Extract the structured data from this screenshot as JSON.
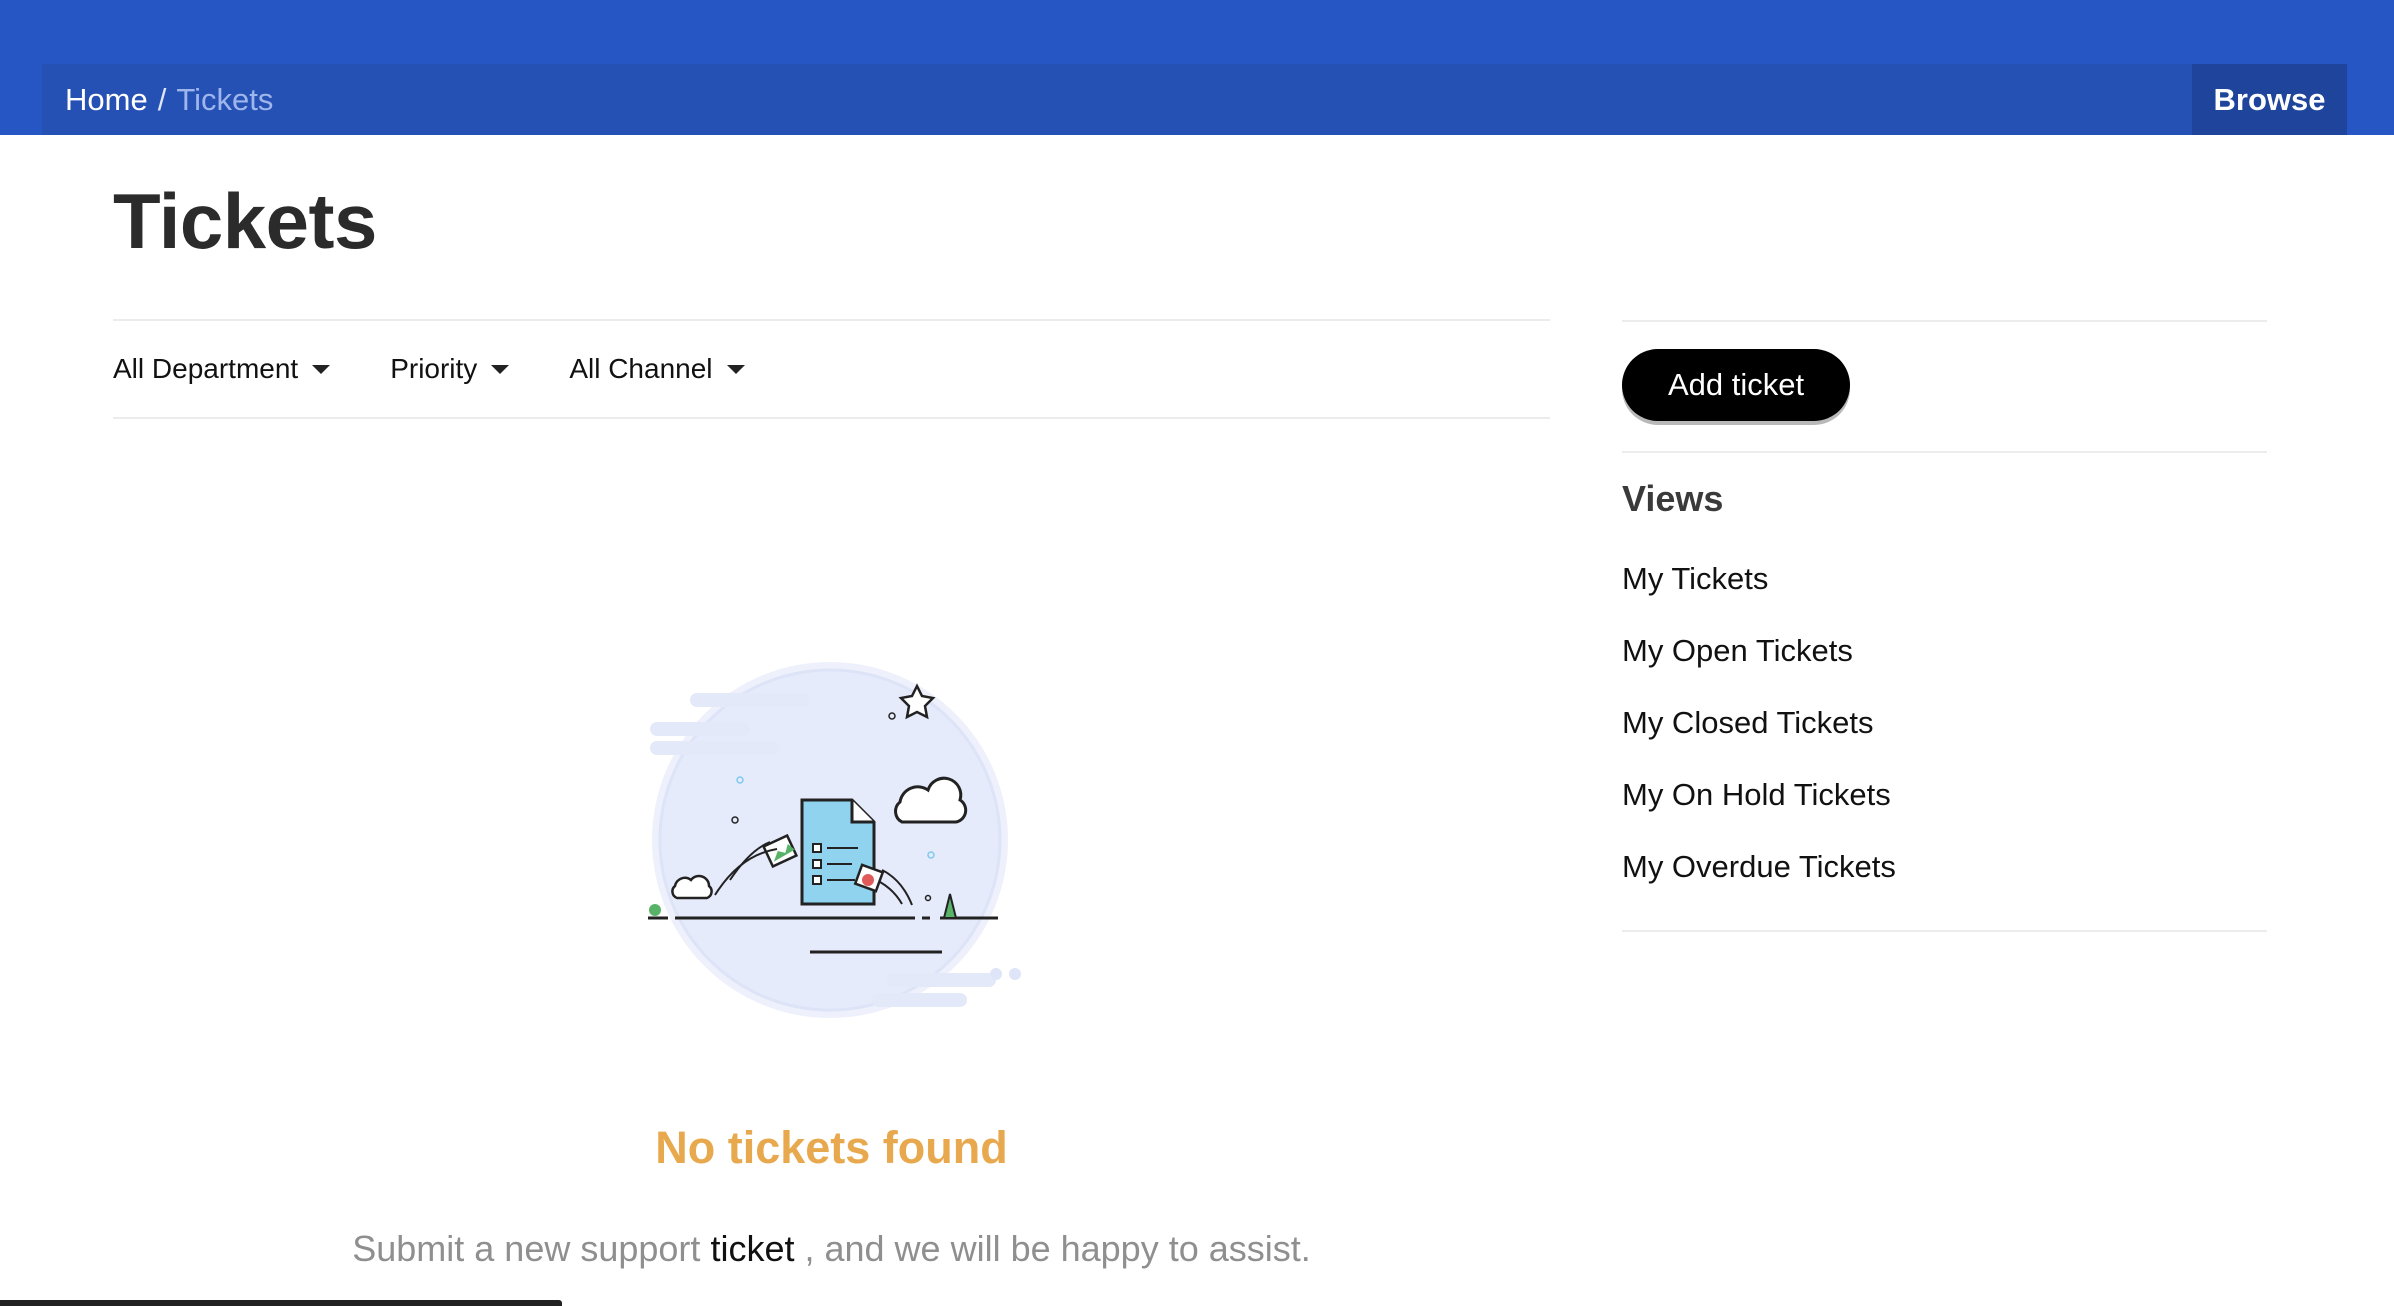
{
  "breadcrumb": {
    "home": "Home",
    "separator": "/",
    "current": "Tickets"
  },
  "header": {
    "browse_label": "Browse"
  },
  "page": {
    "title": "Tickets"
  },
  "filters": [
    {
      "label": "All Department",
      "icon": "caret-down-icon"
    },
    {
      "label": "Priority",
      "icon": "caret-down-icon"
    },
    {
      "label": "All Channel",
      "icon": "caret-down-icon"
    }
  ],
  "empty_state": {
    "title": "No tickets found",
    "sub_before": "Submit a new support",
    "sub_link": "ticket",
    "sub_after": ", and we will be happy to assist."
  },
  "sidebar": {
    "add_ticket_label": "Add ticket",
    "views_title": "Views",
    "views": [
      {
        "label": "My Tickets"
      },
      {
        "label": "My Open Tickets"
      },
      {
        "label": "My Closed Tickets"
      },
      {
        "label": "My On Hold Tickets"
      },
      {
        "label": "My Overdue Tickets"
      }
    ]
  },
  "colors": {
    "header_bg": "#2656c4",
    "breadcrumb_bg": "#2550b4",
    "browse_bg": "#1f449c",
    "empty_title": "#e8a94e",
    "add_ticket_bg": "#000000"
  }
}
